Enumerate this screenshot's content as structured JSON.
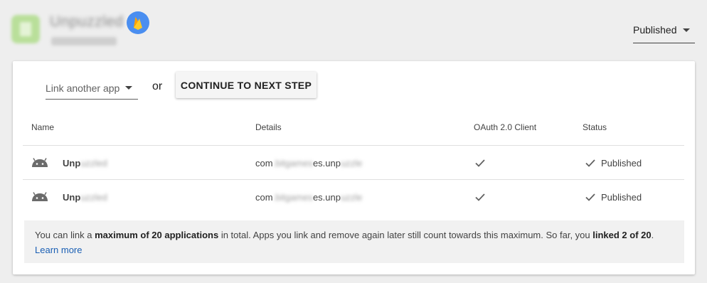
{
  "header": {
    "app_name": "Unpuzzled",
    "app_subtitle": "",
    "status_value": "Published"
  },
  "toolbar": {
    "link_select_label": "Link another app",
    "or_text": "or",
    "continue_label": "CONTINUE TO NEXT STEP"
  },
  "table": {
    "columns": [
      "Name",
      "Details",
      "OAuth 2.0 Client",
      "Status"
    ],
    "rows": [
      {
        "platform_icon": "android-icon",
        "name_visible": "Unp",
        "name_hidden": "uzzled",
        "details_prefix": "com",
        "details_hidden": ".bitgames",
        "details_suffix": "es.unp",
        "details_tail": "uzzle",
        "oauth_icon": "check-icon",
        "status": "Published"
      },
      {
        "platform_icon": "android-icon",
        "name_visible": "Unp",
        "name_hidden": "uzzled",
        "details_prefix": "com",
        "details_hidden": ".bitgames",
        "details_suffix": "es.unp",
        "details_tail": "uzzle",
        "oauth_icon": "check-icon",
        "status": "Published"
      }
    ]
  },
  "info": {
    "t1": "You can link a ",
    "b1": "maximum of 20 applications",
    "t2": " in total. Apps you link and remove again later still count towards this maximum. So far, you ",
    "b2": "linked 2 of 20",
    "t3": ".",
    "learn_more": "Learn more"
  },
  "colors": {
    "background": "#eeeeee",
    "card": "#ffffff",
    "link": "#1a5fb4",
    "firebase_badge": "#4a8ef0"
  }
}
